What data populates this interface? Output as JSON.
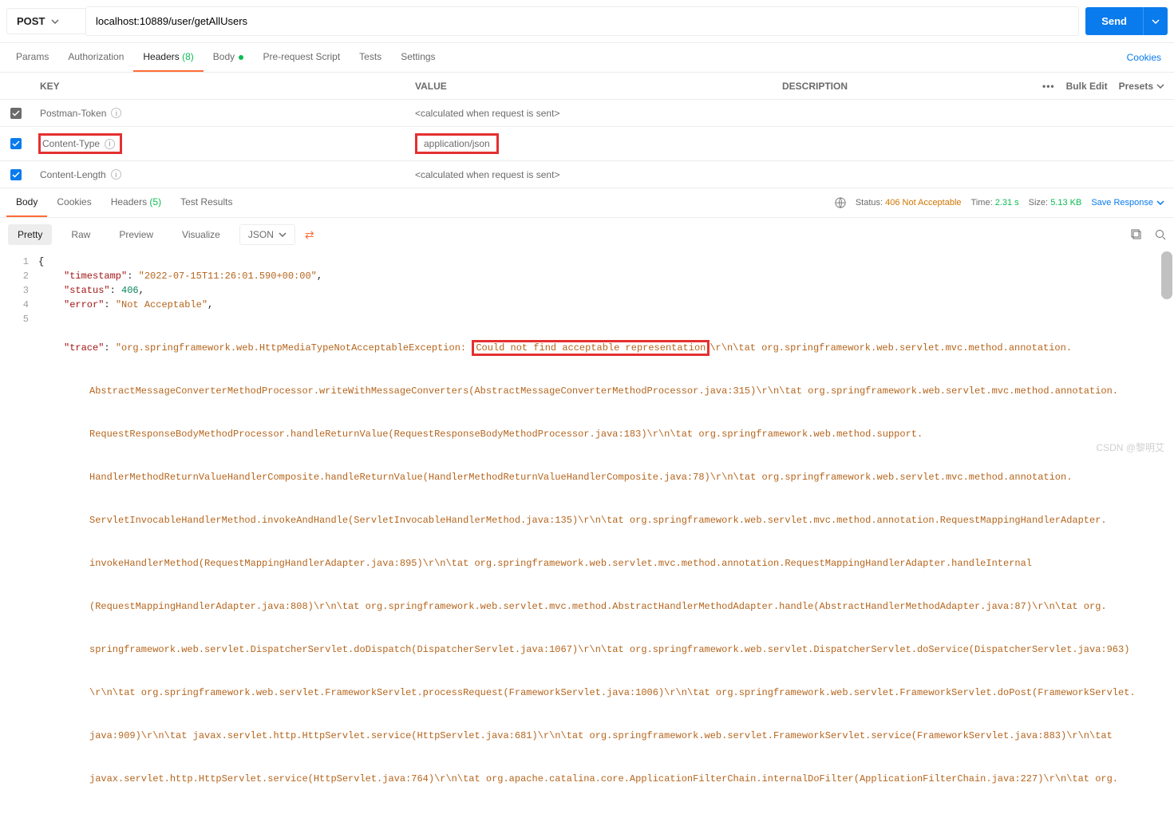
{
  "request": {
    "method": "POST",
    "url": "localhost:10889/user/getAllUsers",
    "send_label": "Send"
  },
  "tabs": {
    "params": "Params",
    "auth": "Authorization",
    "headers": "Headers",
    "headers_count": "(8)",
    "body": "Body",
    "prerequest": "Pre-request Script",
    "tests": "Tests",
    "settings": "Settings",
    "cookies": "Cookies"
  },
  "headers_table": {
    "col_key": "KEY",
    "col_value": "VALUE",
    "col_desc": "DESCRIPTION",
    "bulk_edit": "Bulk Edit",
    "presets": "Presets",
    "rows": [
      {
        "key": "Postman-Token",
        "value": "<calculated when request is sent>",
        "checked": true,
        "blue": false
      },
      {
        "key": "Content-Type",
        "value": "application/json",
        "checked": true,
        "blue": true
      },
      {
        "key": "Content-Length",
        "value": "<calculated when request is sent>",
        "checked": true,
        "blue": true
      }
    ]
  },
  "response_tabs": {
    "body": "Body",
    "cookies": "Cookies",
    "headers": "Headers",
    "headers_count": "(5)",
    "test_results": "Test Results"
  },
  "response_meta": {
    "status_label": "Status:",
    "status_value": "406 Not Acceptable",
    "time_label": "Time:",
    "time_value": "2.31 s",
    "size_label": "Size:",
    "size_value": "5.13 KB",
    "save": "Save Response"
  },
  "view": {
    "pretty": "Pretty",
    "raw": "Raw",
    "preview": "Preview",
    "visualize": "Visualize",
    "lang": "JSON"
  },
  "body": {
    "line1_open": "{",
    "timestamp_key": "\"timestamp\"",
    "timestamp_val": "\"2022-07-15T11:26:01.590+00:00\"",
    "status_key": "\"status\"",
    "status_val": "406",
    "error_key": "\"error\"",
    "error_val": "\"Not Acceptable\"",
    "trace_key": "\"trace\"",
    "trace_pre": "\"org.springframework.web.HttpMediaTypeNotAcceptableException: ",
    "trace_highlight": "Could not find acceptable representation",
    "trace_post1": "\\r\\n\\tat org.springframework.web.servlet.mvc.method.annotation.",
    "trace_line2": "AbstractMessageConverterMethodProcessor.writeWithMessageConverters(AbstractMessageConverterMethodProcessor.java:315)\\r\\n\\tat org.springframework.web.servlet.mvc.method.annotation.",
    "trace_line3": "RequestResponseBodyMethodProcessor.handleReturnValue(RequestResponseBodyMethodProcessor.java:183)\\r\\n\\tat org.springframework.web.method.support.",
    "trace_line4": "HandlerMethodReturnValueHandlerComposite.handleReturnValue(HandlerMethodReturnValueHandlerComposite.java:78)\\r\\n\\tat org.springframework.web.servlet.mvc.method.annotation.",
    "trace_line5": "ServletInvocableHandlerMethod.invokeAndHandle(ServletInvocableHandlerMethod.java:135)\\r\\n\\tat org.springframework.web.servlet.mvc.method.annotation.RequestMappingHandlerAdapter.",
    "trace_line6": "invokeHandlerMethod(RequestMappingHandlerAdapter.java:895)\\r\\n\\tat org.springframework.web.servlet.mvc.method.annotation.RequestMappingHandlerAdapter.handleInternal",
    "trace_line7": "(RequestMappingHandlerAdapter.java:808)\\r\\n\\tat org.springframework.web.servlet.mvc.method.AbstractHandlerMethodAdapter.handle(AbstractHandlerMethodAdapter.java:87)\\r\\n\\tat org.",
    "trace_line8": "springframework.web.servlet.DispatcherServlet.doDispatch(DispatcherServlet.java:1067)\\r\\n\\tat org.springframework.web.servlet.DispatcherServlet.doService(DispatcherServlet.java:963)",
    "trace_line9": "\\r\\n\\tat org.springframework.web.servlet.FrameworkServlet.processRequest(FrameworkServlet.java:1006)\\r\\n\\tat org.springframework.web.servlet.FrameworkServlet.doPost(FrameworkServlet.",
    "trace_line10": "java:909)\\r\\n\\tat javax.servlet.http.HttpServlet.service(HttpServlet.java:681)\\r\\n\\tat org.springframework.web.servlet.FrameworkServlet.service(FrameworkServlet.java:883)\\r\\n\\tat",
    "trace_line11": "javax.servlet.http.HttpServlet.service(HttpServlet.java:764)\\r\\n\\tat org.apache.catalina.core.ApplicationFilterChain.internalDoFilter(ApplicationFilterChain.java:227)\\r\\n\\tat org."
  },
  "watermark": "CSDN @黎明艾"
}
